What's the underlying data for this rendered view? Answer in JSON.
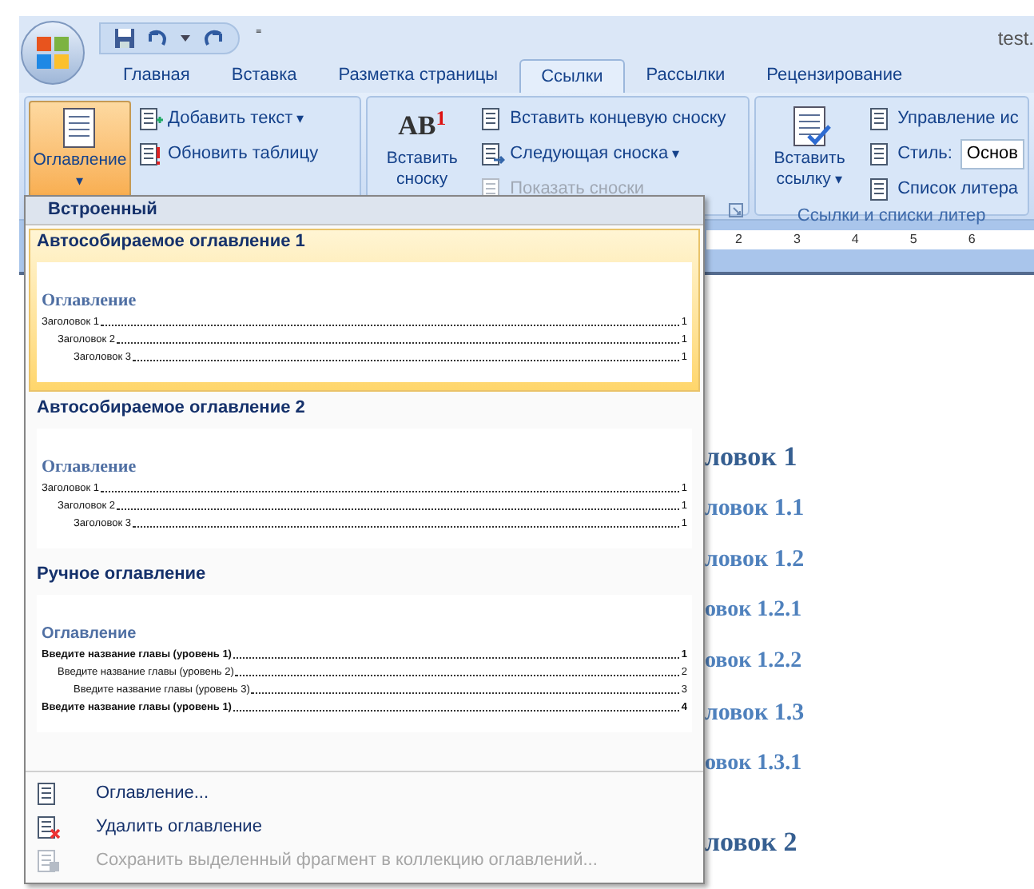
{
  "window": {
    "title": "test."
  },
  "quick_access": {
    "customize": "⁼"
  },
  "tabs": [
    {
      "label": "Главная",
      "selected": false
    },
    {
      "label": "Вставка",
      "selected": false
    },
    {
      "label": "Разметка страницы",
      "selected": false
    },
    {
      "label": "Ссылки",
      "selected": true
    },
    {
      "label": "Рассылки",
      "selected": false
    },
    {
      "label": "Рецензирование",
      "selected": false
    }
  ],
  "ribbon": {
    "groups": [
      {
        "big": {
          "label": "Оглавление",
          "caret": "▾",
          "pressed": true
        },
        "small": [
          {
            "label": "Добавить текст",
            "caret": "▾",
            "disabled": false
          },
          {
            "label": "Обновить таблицу",
            "disabled": false
          }
        ]
      },
      {
        "big": {
          "label": "Вставить сноску",
          "pressed": false,
          "mark": "AB",
          "mark_sup": "1"
        },
        "small": [
          {
            "label": "Вставить концевую сноску",
            "disabled": false
          },
          {
            "label": "Следующая сноска",
            "caret": "▾",
            "disabled": false
          },
          {
            "label": "Показать сноски",
            "disabled": true
          }
        ]
      },
      {
        "big": {
          "label": "Вставить ссылку",
          "caret": "▾",
          "pressed": false
        },
        "small": [
          {
            "label": "Управление ис",
            "disabled": false
          },
          {
            "label": "Стиль:",
            "disabled": false,
            "value": "Основ"
          },
          {
            "label": "Список литера",
            "disabled": false
          }
        ],
        "footer": "Ссылки и списки литер"
      }
    ]
  },
  "ruler": {
    "numbers": [
      "2",
      "3",
      "4",
      "5",
      "6"
    ]
  },
  "document": {
    "headings": [
      {
        "text": "ловок 1",
        "kind": "h1"
      },
      {
        "text": "ловок 1.1",
        "kind": "h2"
      },
      {
        "text": "ловок 1.2",
        "kind": "h2"
      },
      {
        "text": "овок 1.2.1",
        "kind": "h3"
      },
      {
        "text": "овок 1.2.2",
        "kind": "h3"
      },
      {
        "text": "ловок 1.3",
        "kind": "h2"
      },
      {
        "text": "овок 1.3.1",
        "kind": "h3"
      },
      {
        "text": "ловок 2",
        "kind": "h1"
      }
    ]
  },
  "menu": {
    "header": "Встроенный",
    "gallery": [
      {
        "title": "Автособираемое оглавление 1",
        "kind": "auto",
        "selected": true,
        "preview": {
          "heading": "Оглавление",
          "entries": [
            {
              "text": "Заголовок 1",
              "page": "1",
              "children": [
                {
                  "text": "Заголовок 2",
                  "page": "1",
                  "children": [
                    {
                      "text": "Заголовок 3",
                      "page": "1"
                    }
                  ]
                }
              ]
            }
          ]
        }
      },
      {
        "title": "Автособираемое оглавление 2",
        "kind": "auto",
        "selected": false,
        "preview": {
          "heading": "Оглавление",
          "entries": [
            {
              "text": "Заголовок 1",
              "page": "1",
              "children": [
                {
                  "text": "Заголовок 2",
                  "page": "1",
                  "children": [
                    {
                      "text": "Заголовок 3",
                      "page": "1"
                    }
                  ]
                }
              ]
            }
          ]
        }
      },
      {
        "title": "Ручное оглавление",
        "kind": "manual",
        "selected": false,
        "preview": {
          "heading": "Оглавление",
          "entries": [
            {
              "text": "Введите название главы (уровень 1)",
              "page": "1",
              "children": [
                {
                  "text": "Введите название главы (уровень 2)",
                  "page": "2",
                  "children": [
                    {
                      "text": "Введите название главы (уровень 3)",
                      "page": "3"
                    }
                  ]
                }
              ]
            },
            {
              "text": "Введите название главы (уровень 1)",
              "page": "4"
            }
          ]
        }
      }
    ],
    "commands": [
      {
        "label": "Оглавление...",
        "disabled": false
      },
      {
        "label": "Удалить оглавление",
        "disabled": false
      },
      {
        "label": "Сохранить выделенный фрагмент в коллекцию оглавлений...",
        "disabled": true
      }
    ]
  }
}
